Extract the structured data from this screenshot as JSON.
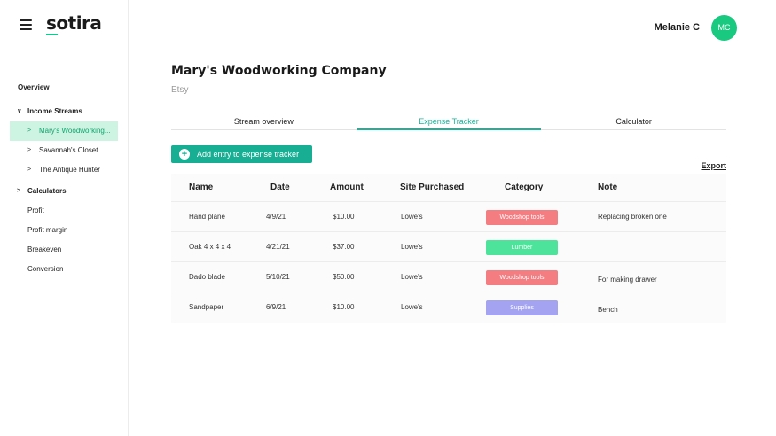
{
  "app": {
    "logo_text": "sotira",
    "brand_color": "#1bc48b"
  },
  "sidebar": {
    "overview": "Overview",
    "income_streams": {
      "label": "Income Streams",
      "items": [
        {
          "label": "Mary's Woodworking...",
          "active": true
        },
        {
          "label": "Savannah's Closet"
        },
        {
          "label": "The Antique Hunter"
        }
      ]
    },
    "calculators": {
      "label": "Calculators",
      "items": [
        {
          "label": "Profit"
        },
        {
          "label": "Profit margin"
        },
        {
          "label": "Breakeven"
        },
        {
          "label": "Conversion"
        }
      ]
    }
  },
  "header": {
    "user_name": "Melanie C",
    "avatar_initials": "MC",
    "avatar_color": "#18c97f"
  },
  "main": {
    "title": "Mary's Woodworking Company",
    "subtitle": "Etsy",
    "tabs": [
      {
        "label": "Stream overview"
      },
      {
        "label": "Expense Tracker",
        "active": true
      },
      {
        "label": "Calculator"
      }
    ],
    "add_button": "Add entry to expense tracker",
    "export": "Export",
    "table": {
      "columns": [
        "Name",
        "Date",
        "Amount",
        "Site Purchased",
        "Category",
        "Note"
      ],
      "rows": [
        {
          "name": "Hand plane",
          "date": "4/9/21",
          "amount": "$10.00",
          "site": "Lowe's",
          "category": "Woodshop tools",
          "category_color": "#f47d82",
          "note": "Replacing broken one"
        },
        {
          "name": "Oak 4 x 4 x 4",
          "date": "4/21/21",
          "amount": "$37.00",
          "site": "Lowe's",
          "category": "Lumber",
          "category_color": "#4ee39a",
          "note": ""
        },
        {
          "name": "Dado blade",
          "date": "5/10/21",
          "amount": "$50.00",
          "site": "Lowe's",
          "category": "Woodshop tools",
          "category_color": "#f47d82",
          "note": "For making drawer"
        },
        {
          "name": "Sandpaper",
          "date": "6/9/21",
          "amount": "$10.00",
          "site": "Lowe's",
          "category": "Supplies",
          "category_color": "#a3a3f2",
          "note": "Bench"
        }
      ]
    }
  }
}
